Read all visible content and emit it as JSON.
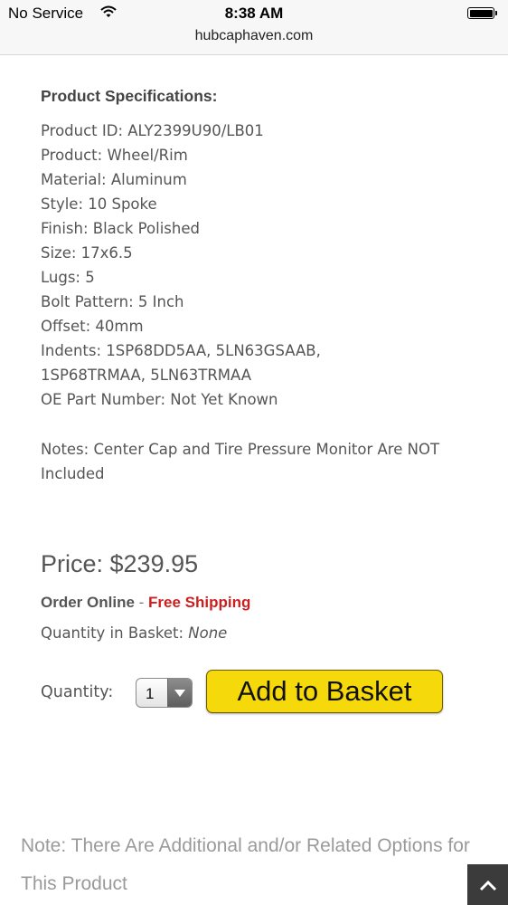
{
  "status_bar": {
    "carrier": "No Service",
    "time": "8:38 AM",
    "url": "hubcaphaven.com",
    "wifi_icon": "wifi-icon",
    "battery_icon": "battery-icon"
  },
  "specs": {
    "title": "Product Specifications:",
    "items": [
      "Product ID: ALY2399U90/LB01",
      "Product: Wheel/Rim",
      "Material: Aluminum",
      "Style: 10 Spoke",
      "Finish: Black Polished",
      "Size: 17x6.5",
      "Lugs: 5",
      "Bolt Pattern: 5 Inch",
      "Offset: 40mm",
      "Indents: 1SP68DD5AA, 5LN63GSAAB,",
      "1SP68TRMAA, 5LN63TRMAA",
      "OE Part Number: Not Yet Known"
    ],
    "notes": "Notes: Center Cap and Tire Pressure Monitor Are NOT Included"
  },
  "purchase": {
    "price": "Price: $239.95",
    "order_online": "Order Online",
    "separator": " - ",
    "free_shipping": "Free Shipping",
    "basket_label": "Quantity in Basket: ",
    "basket_value": "None",
    "quantity_label": "Quantity:",
    "quantity_value": "1",
    "add_button": "Add to Basket"
  },
  "related": {
    "text": "Note: There Are Additional and/or Related Options for This Product"
  },
  "colors": {
    "accent_red": "#cc1f1f",
    "button_yellow": "#f5d90a"
  }
}
